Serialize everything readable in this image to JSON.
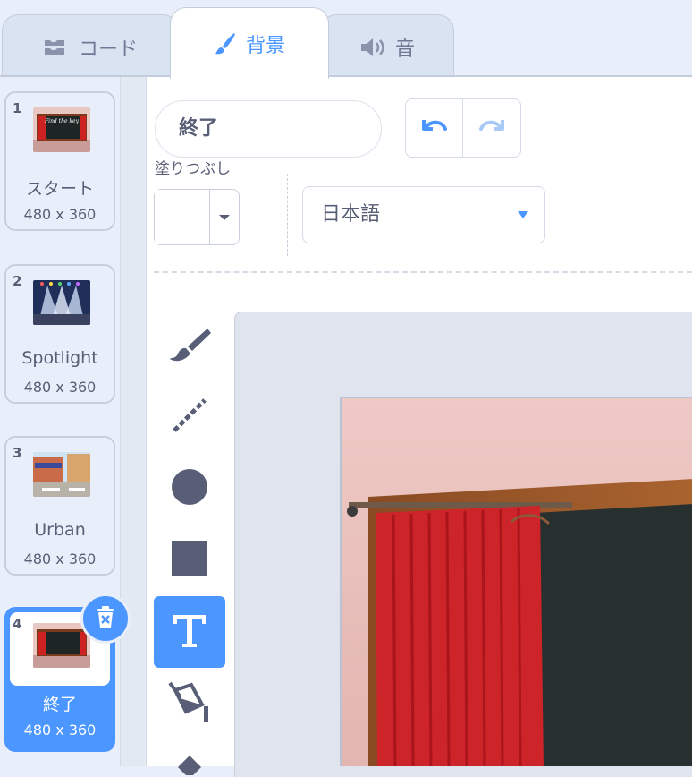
{
  "tabs": [
    {
      "label": "コード",
      "icon": "code-blocks-icon"
    },
    {
      "label": "背景",
      "icon": "paintbrush-icon",
      "selected": true
    },
    {
      "label": "音",
      "icon": "speaker-icon"
    }
  ],
  "backdrops": [
    {
      "number": "1",
      "name": "スタート",
      "size": "480 x 360",
      "thumbnail": "stage-curtain-find-the-key"
    },
    {
      "number": "2",
      "name": "Spotlight",
      "size": "480 x 360",
      "thumbnail": "spotlight-stage"
    },
    {
      "number": "3",
      "name": "Urban",
      "size": "480 x 360",
      "thumbnail": "urban-street"
    },
    {
      "number": "4",
      "name": "終了",
      "size": "480 x 360",
      "thumbnail": "stage-curtain",
      "selected": true
    }
  ],
  "editor": {
    "costume_name": "終了",
    "fill_label": "塗りつぶし",
    "fill_color": "#ffffff",
    "font_value": "日本語",
    "active_tool": "text"
  },
  "colors": {
    "accent": "#4c97ff",
    "tab_inactive": "#d9e3f2",
    "text": "#575e75"
  }
}
